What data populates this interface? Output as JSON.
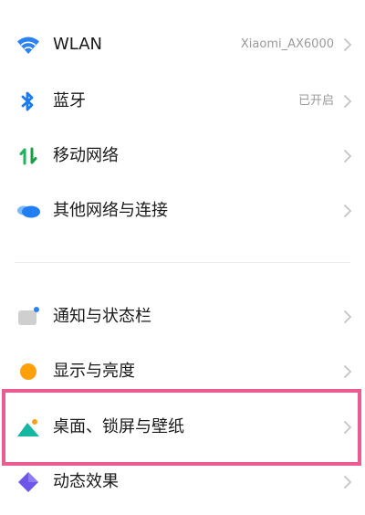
{
  "colors": {
    "wlan": "#2b82f6",
    "bluetooth": "#1b7bf0",
    "mobile_up": "#1fb35b",
    "mobile_down": "#1c9e47",
    "cloud": "#1e7ef2",
    "notify": "#cfcfcf",
    "notify_dot": "#2b82f6",
    "display": "#ff9f0a",
    "wallpaper_teal": "#16b6a3",
    "wallpaper_sun": "#ff9f1a",
    "effects": "#6e57e8",
    "highlight": "#ea5b90"
  },
  "settings": {
    "network": [
      {
        "label": "WLAN",
        "value": "Xiaomi_AX6000",
        "icon": "wifi-icon"
      },
      {
        "label": "蓝牙",
        "value": "已开启",
        "icon": "bluetooth-icon"
      },
      {
        "label": "移动网络",
        "value": "",
        "icon": "mobile-network-icon"
      },
      {
        "label": "其他网络与连接",
        "value": "",
        "icon": "cloud-icon"
      }
    ],
    "personal": [
      {
        "label": "通知与状态栏",
        "value": "",
        "icon": "notification-icon"
      },
      {
        "label": "显示与亮度",
        "value": "",
        "icon": "display-icon"
      },
      {
        "label": "桌面、锁屏与壁纸",
        "value": "",
        "icon": "wallpaper-icon"
      },
      {
        "label": "动态效果",
        "value": "",
        "icon": "effects-icon"
      }
    ]
  }
}
